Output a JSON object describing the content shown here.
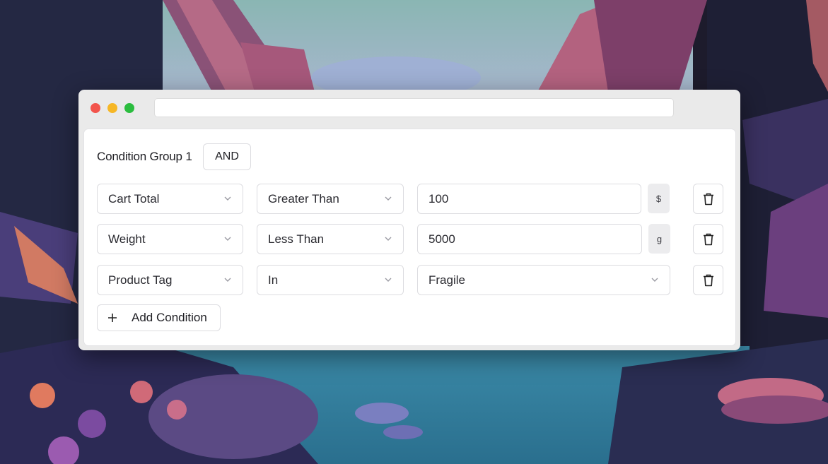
{
  "group": {
    "title": "Condition Group 1",
    "operator": "AND"
  },
  "conditions": [
    {
      "field": "Cart Total",
      "comparator": "Greater Than",
      "value": "100",
      "unit": "$"
    },
    {
      "field": "Weight",
      "comparator": "Less Than",
      "value": "5000",
      "unit": "g"
    },
    {
      "field": "Product Tag",
      "comparator": "In",
      "value": "Fragile"
    }
  ],
  "add_condition_label": "Add Condition",
  "colors": {
    "close": "#f2544c",
    "minimize": "#f6b726",
    "zoom": "#2bbd3f"
  },
  "icons": {
    "dropdown": "chevron-down-icon",
    "delete": "trash-icon",
    "add": "plus-icon"
  }
}
